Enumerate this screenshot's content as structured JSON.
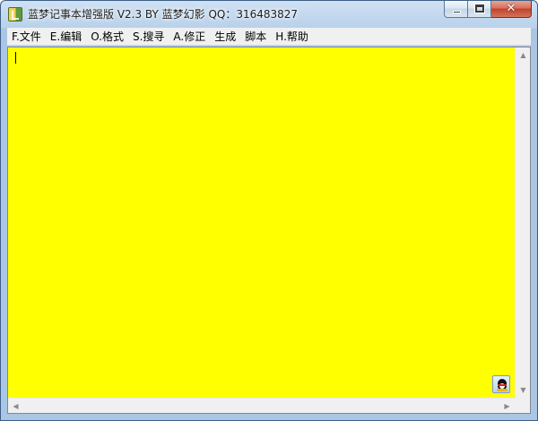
{
  "window": {
    "title": "蓝梦记事本增强版 V2.3 BY 蓝梦幻影 QQ：316483827",
    "close_glyph": "✕"
  },
  "menu": {
    "items": [
      {
        "label": "F.文件"
      },
      {
        "label": "E.编辑"
      },
      {
        "label": "O.格式"
      },
      {
        "label": "S.搜寻"
      },
      {
        "label": "A.修正"
      },
      {
        "label": "生成"
      },
      {
        "label": "脚本"
      },
      {
        "label": "H.帮助"
      }
    ]
  },
  "editor": {
    "text": "",
    "background_color": "#ffff00"
  },
  "scrollbars": {
    "up_arrow": "▲",
    "down_arrow": "▼",
    "left_arrow": "◀",
    "right_arrow": "▶"
  },
  "icons": {
    "app": "notebook-icon",
    "qq": "qq-penguin-icon"
  }
}
